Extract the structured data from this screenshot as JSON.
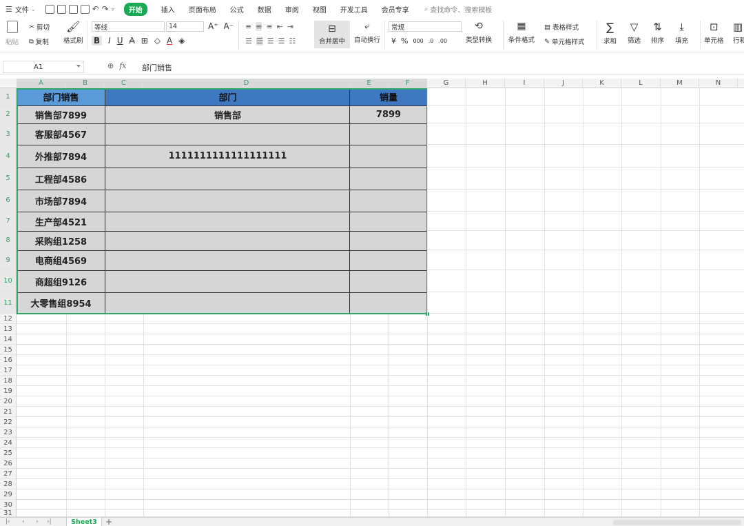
{
  "menu": {
    "file": "文件",
    "tabs": [
      "开始",
      "插入",
      "页面布局",
      "公式",
      "数据",
      "审阅",
      "视图",
      "开发工具",
      "会员专享"
    ],
    "active_tab": "开始",
    "search": "查找命令、搜索模板"
  },
  "ribbon": {
    "paste": "粘贴",
    "cut": "剪切",
    "copy": "复制",
    "format_painter": "格式刷",
    "font_name": "等线",
    "font_size": "14",
    "merge_center": "合并居中",
    "wrap_text": "自动换行",
    "number_format": "常规",
    "currency": "¥",
    "percent": "%",
    "type_convert": "类型转换",
    "conditional_format": "条件格式",
    "table_style": "表格样式",
    "cell_style": "单元格样式",
    "sum": "求和",
    "filter": "筛选",
    "sort": "排序",
    "fill": "填充",
    "cell": "单元格",
    "row_col": "行和"
  },
  "formula_bar": {
    "cell_ref": "A1",
    "fx": "fx",
    "content": "部门销售"
  },
  "columns": [
    "A",
    "B",
    "C",
    "D",
    "E",
    "F",
    "G",
    "H",
    "I",
    "J",
    "K",
    "L",
    "M",
    "N"
  ],
  "rows": [
    "1",
    "2",
    "3",
    "4",
    "5",
    "6",
    "7",
    "8",
    "9",
    "10",
    "11",
    "12",
    "13",
    "14",
    "15",
    "16",
    "17",
    "18",
    "19",
    "20",
    "21",
    "22",
    "23",
    "24",
    "25",
    "26",
    "27",
    "28",
    "29",
    "30",
    "31"
  ],
  "table": {
    "header_a": "部门销售",
    "header_d": "部门",
    "header_e": "销量",
    "col_a": [
      "销售部7899",
      "客服部4567",
      "外推部7894",
      "工程部4586",
      "市场部7894",
      "生产部4521",
      "采购组1258",
      "电商组4569",
      "商超组9126",
      "大零售组8954"
    ],
    "d2": "销售部",
    "e2": "7899",
    "d4": "1111111111111111111"
  },
  "sheet_tabs": {
    "active": "Sheet3",
    "add": "+"
  },
  "colors": {
    "accent": "#1aaa55",
    "header_blue": "#3d78c0",
    "header_blue_light": "#5c9bd9",
    "selection_gray": "#d6d6d6",
    "selection_border": "#2fa56a"
  }
}
